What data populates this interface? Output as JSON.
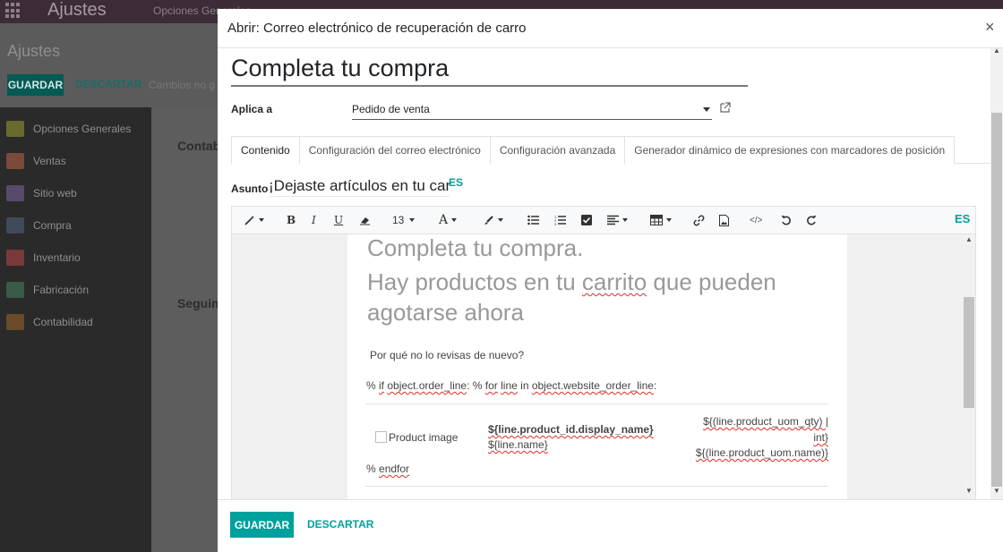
{
  "background": {
    "app_name": "Ajustes",
    "menu_first": "Opciones Generales",
    "breadcrumb": "Ajustes",
    "save_label": "GUARDAR",
    "discard_label": "DESCARTAR",
    "unsaved": "Cambios no g",
    "sidebar": [
      {
        "label": "Opciones Generales",
        "color": "#6b6a2e"
      },
      {
        "label": "Ventas",
        "color": "#7a4a3a"
      },
      {
        "label": "Sitio web",
        "color": "#5a4a6a"
      },
      {
        "label": "Compra",
        "color": "#3f4a5a"
      },
      {
        "label": "Inventario",
        "color": "#7a3a3a"
      },
      {
        "label": "Fabricación",
        "color": "#3a5a4a"
      },
      {
        "label": "Contabilidad",
        "color": "#6a4a2a"
      }
    ],
    "sections": [
      "Contabi",
      "Seguim"
    ]
  },
  "modal": {
    "title": "Abrir: Correo electrónico de recuperación de carro",
    "close_glyph": "×",
    "record_name": "Completa tu compra",
    "applies_label": "Aplica a",
    "applies_value": "Pedido de venta",
    "tabs": [
      "Contenido",
      "Configuración del correo electrónico",
      "Configuración avanzada",
      "Generador dinámico de expresiones con marcadores de posición"
    ],
    "subject_label": "Asunto",
    "subject_value": "¡Dejaste artículos en tu carrito!",
    "lang": "ES",
    "toolbar": {
      "font_size": "13"
    },
    "body": {
      "heading": "Completa tu compra.",
      "subheading_pre": "Hay productos en tu ",
      "subheading_word": "carrito",
      "subheading_post": " que pueden agotarse ahora",
      "question": "Por qué no lo revisas de nuevo?",
      "loop_pct": "% ",
      "loop_if": "if",
      "loop_var1": "object.order_line",
      "loop_mid": ": % ",
      "loop_for": "for",
      "loop_line": "line",
      "loop_in": " in ",
      "loop_var2": "object.website_order_line",
      "loop_end": ":",
      "product_image": "Product image",
      "product_name_expr": "${line.product_id.display_name}",
      "line_name_expr": "${line.name}",
      "qty_expr_1": "${(line.product_uom_qty) |",
      "qty_expr_2": "int}",
      "uom_expr": "${(line.product_uom.name)}",
      "endfor_pct": "% ",
      "endfor": "endfor"
    },
    "footer": {
      "save": "GUARDAR",
      "discard": "DESCARTAR"
    }
  }
}
